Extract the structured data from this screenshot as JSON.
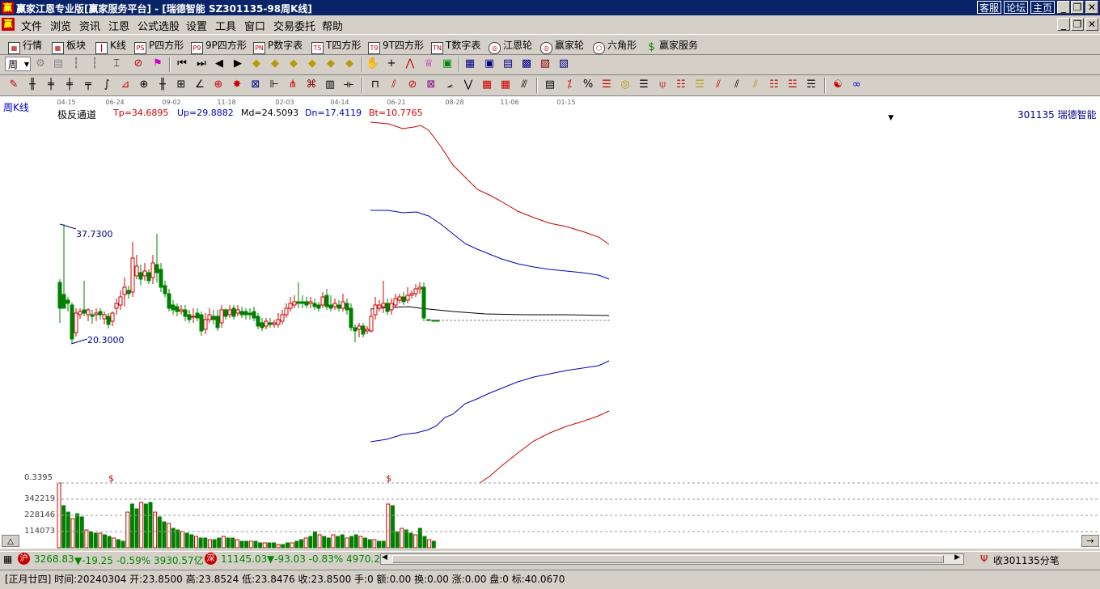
{
  "window": {
    "title": "赢家江恩专业版[赢家服务平台] - [瑞德智能  SZ301135-98周K线]",
    "links": [
      "客服",
      "论坛",
      "主页"
    ],
    "logo": "赢"
  },
  "menu": [
    "文件",
    "浏览",
    "资讯",
    "江恩",
    "公式选股",
    "设置",
    "工具",
    "窗口",
    "交易委托",
    "帮助"
  ],
  "toolbar1": [
    {
      "label": "行情",
      "icon": "table-icon"
    },
    {
      "label": "板块",
      "icon": "grid-icon"
    },
    {
      "label": "K线",
      "icon": "candles-icon"
    },
    {
      "label": "P四方形",
      "icon": "P-square-icon",
      "badge": "PS"
    },
    {
      "label": "9P四方形",
      "icon": "9P-square-icon",
      "badge": "P9"
    },
    {
      "label": "P数字表",
      "icon": "P-table-icon",
      "badge": "PN"
    },
    {
      "label": "T四方形",
      "icon": "T-square-icon",
      "badge": "TS"
    },
    {
      "label": "9T四方形",
      "icon": "9T-square-icon",
      "badge": "T9"
    },
    {
      "label": "T数字表",
      "icon": "T-table-icon",
      "badge": "TN"
    },
    {
      "label": "江恩轮",
      "icon": "wheel-icon"
    },
    {
      "label": "赢家轮",
      "icon": "wheel2-icon"
    },
    {
      "label": "六角形",
      "icon": "hexagon-icon"
    },
    {
      "label": "赢家服务",
      "icon": "dollar-icon"
    }
  ],
  "period_select": "周",
  "chart": {
    "period_label": "周K线",
    "date_ticks": [
      "04-15",
      "06-24",
      "09-02",
      "11-18",
      "02-03",
      "04-14",
      "06-21",
      "08-28",
      "11-06",
      "01-15"
    ],
    "indicator_name": "极反通道",
    "indicator_values": [
      {
        "label": "Tp=34.6895",
        "color": "#d00000"
      },
      {
        "label": "Up=29.8882",
        "color": "#0000c0"
      },
      {
        "label": "Md=24.5093",
        "color": "#000000"
      },
      {
        "label": "Dn=17.4119",
        "color": "#0000c0"
      },
      {
        "label": "Bt=10.7765",
        "color": "#d00000"
      }
    ],
    "stock_label": "301135 瑞德智能",
    "high_label": "37.7300",
    "low_label": "20.3000",
    "volume_scale": [
      "0.3395",
      "342219",
      "228146",
      "114073"
    ],
    "markers": [
      "$",
      "$"
    ]
  },
  "status": {
    "sh_index": "3268.83",
    "sh_change": "▼-19.25 -0.59% 3930.57亿",
    "sz_index": "11145.03",
    "sz_change": "▼-93.03 -0.83% 4970.2",
    "right_text": "收301135分笔",
    "sh_badge": "沪",
    "sz_badge": "深"
  },
  "bottom": "[正月廿四] 时间:20240304 开:23.8500 高:23.8524 低:23.8476 收:23.8500 手:0 额:0.00 换:0.00 涨:0.00 盘:0 标:40.0670",
  "colors": {
    "up": "#d00000",
    "down": "#008000",
    "channel_outer": "#d00000",
    "channel_inner": "#0000c0"
  }
}
